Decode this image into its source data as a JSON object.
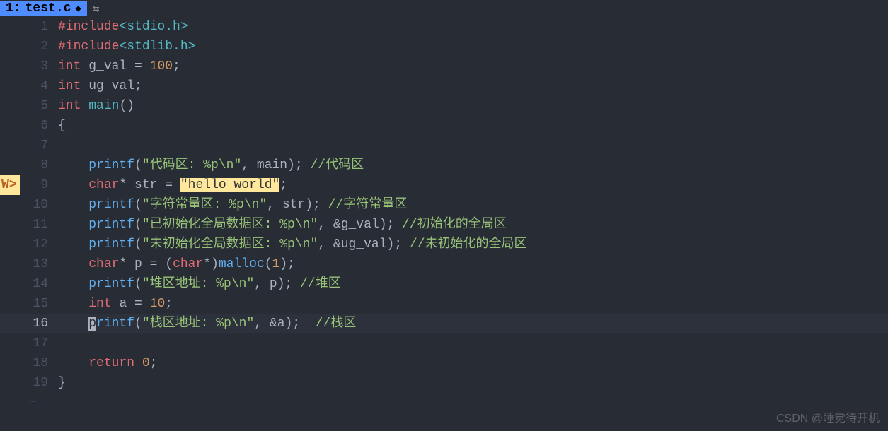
{
  "tab": {
    "index": "1:",
    "filename": "test.c",
    "modified_glyph": "◆",
    "arrows": "⇆"
  },
  "warning_badge": "W>",
  "lines": [
    {
      "n": 1,
      "tokens": [
        [
          "tok-preh",
          "#include"
        ],
        [
          "tok-inc",
          "<stdio.h>"
        ]
      ]
    },
    {
      "n": 2,
      "tokens": [
        [
          "tok-preh",
          "#include"
        ],
        [
          "tok-inc",
          "<stdlib.h>"
        ]
      ]
    },
    {
      "n": 3,
      "tokens": [
        [
          "tok-kw",
          "int "
        ],
        [
          "tok-id",
          "g_val "
        ],
        [
          "tok-op",
          "= "
        ],
        [
          "tok-num",
          "100"
        ],
        [
          "tok-punc",
          ";"
        ]
      ]
    },
    {
      "n": 4,
      "tokens": [
        [
          "tok-kw",
          "int "
        ],
        [
          "tok-id",
          "ug_val"
        ],
        [
          "tok-punc",
          ";"
        ]
      ]
    },
    {
      "n": 5,
      "tokens": [
        [
          "tok-kw",
          "int "
        ],
        [
          "tok-main",
          "main"
        ],
        [
          "tok-punc",
          "()"
        ]
      ]
    },
    {
      "n": 6,
      "tokens": [
        [
          "tok-punc",
          "{"
        ]
      ]
    },
    {
      "n": 7,
      "tokens": []
    },
    {
      "n": 8,
      "indent": 2,
      "tokens": [
        [
          "tok-func",
          "printf"
        ],
        [
          "tok-punc",
          "("
        ],
        [
          "tok-str",
          "\"代码区: %p\\n\""
        ],
        [
          "tok-punc",
          ", "
        ],
        [
          "tok-id",
          "main"
        ],
        [
          "tok-punc",
          "); "
        ],
        [
          "tok-cmtg",
          "//代码区"
        ]
      ]
    },
    {
      "n": 9,
      "indent": 2,
      "warn": true,
      "tokens": [
        [
          "tok-kw",
          "char"
        ],
        [
          "tok-op",
          "* "
        ],
        [
          "tok-id",
          "str "
        ],
        [
          "tok-op",
          "= "
        ],
        [
          "tok-strhl",
          "\"hello world\""
        ],
        [
          "tok-punc",
          ";"
        ]
      ]
    },
    {
      "n": 10,
      "indent": 2,
      "tokens": [
        [
          "tok-func",
          "printf"
        ],
        [
          "tok-punc",
          "("
        ],
        [
          "tok-str",
          "\"字符常量区: %p\\n\""
        ],
        [
          "tok-punc",
          ", "
        ],
        [
          "tok-id",
          "str"
        ],
        [
          "tok-punc",
          "); "
        ],
        [
          "tok-cmtg",
          "//字符常量区"
        ]
      ]
    },
    {
      "n": 11,
      "indent": 2,
      "tokens": [
        [
          "tok-func",
          "printf"
        ],
        [
          "tok-punc",
          "("
        ],
        [
          "tok-str",
          "\"已初始化全局数据区: %p\\n\""
        ],
        [
          "tok-punc",
          ", "
        ],
        [
          "tok-op",
          "&"
        ],
        [
          "tok-id",
          "g_val"
        ],
        [
          "tok-punc",
          "); "
        ],
        [
          "tok-cmtg",
          "//初始化的全局区"
        ]
      ]
    },
    {
      "n": 12,
      "indent": 2,
      "tokens": [
        [
          "tok-func",
          "printf"
        ],
        [
          "tok-punc",
          "("
        ],
        [
          "tok-str",
          "\"未初始化全局数据区: %p\\n\""
        ],
        [
          "tok-punc",
          ", "
        ],
        [
          "tok-op",
          "&"
        ],
        [
          "tok-id",
          "ug_val"
        ],
        [
          "tok-punc",
          "); "
        ],
        [
          "tok-cmtg",
          "//未初始化的全局区"
        ]
      ]
    },
    {
      "n": 13,
      "indent": 2,
      "tokens": [
        [
          "tok-kw",
          "char"
        ],
        [
          "tok-op",
          "* "
        ],
        [
          "tok-id",
          "p "
        ],
        [
          "tok-op",
          "= "
        ],
        [
          "tok-punc",
          "("
        ],
        [
          "tok-kw",
          "char"
        ],
        [
          "tok-op",
          "*"
        ],
        [
          "tok-punc",
          ")"
        ],
        [
          "tok-func",
          "malloc"
        ],
        [
          "tok-punc",
          "("
        ],
        [
          "tok-num",
          "1"
        ],
        [
          "tok-punc",
          ");"
        ]
      ]
    },
    {
      "n": 14,
      "indent": 2,
      "tokens": [
        [
          "tok-func",
          "printf"
        ],
        [
          "tok-punc",
          "("
        ],
        [
          "tok-str",
          "\"堆区地址: %p\\n\""
        ],
        [
          "tok-punc",
          ", "
        ],
        [
          "tok-id",
          "p"
        ],
        [
          "tok-punc",
          "); "
        ],
        [
          "tok-cmtg",
          "//堆区"
        ]
      ]
    },
    {
      "n": 15,
      "indent": 2,
      "tokens": [
        [
          "tok-kw",
          "int "
        ],
        [
          "tok-id",
          "a "
        ],
        [
          "tok-op",
          "= "
        ],
        [
          "tok-num",
          "10"
        ],
        [
          "tok-punc",
          ";"
        ]
      ]
    },
    {
      "n": 16,
      "indent": 2,
      "current": true,
      "tokens": [
        [
          "cursor",
          "p"
        ],
        [
          "tok-func",
          "rintf"
        ],
        [
          "tok-punc",
          "("
        ],
        [
          "tok-str",
          "\"栈区地址: %p\\n\""
        ],
        [
          "tok-punc",
          ", "
        ],
        [
          "tok-op",
          "&"
        ],
        [
          "tok-id",
          "a"
        ],
        [
          "tok-punc",
          ");  "
        ],
        [
          "tok-cmtg",
          "//栈区"
        ]
      ]
    },
    {
      "n": 17,
      "tokens": []
    },
    {
      "n": 18,
      "indent": 2,
      "tokens": [
        [
          "tok-kw",
          "return "
        ],
        [
          "tok-num",
          "0"
        ],
        [
          "tok-punc",
          ";"
        ]
      ]
    },
    {
      "n": 19,
      "tokens": [
        [
          "tok-punc",
          "}"
        ]
      ]
    }
  ],
  "tilde": "~",
  "watermark": "CSDN @睡觉待开机"
}
